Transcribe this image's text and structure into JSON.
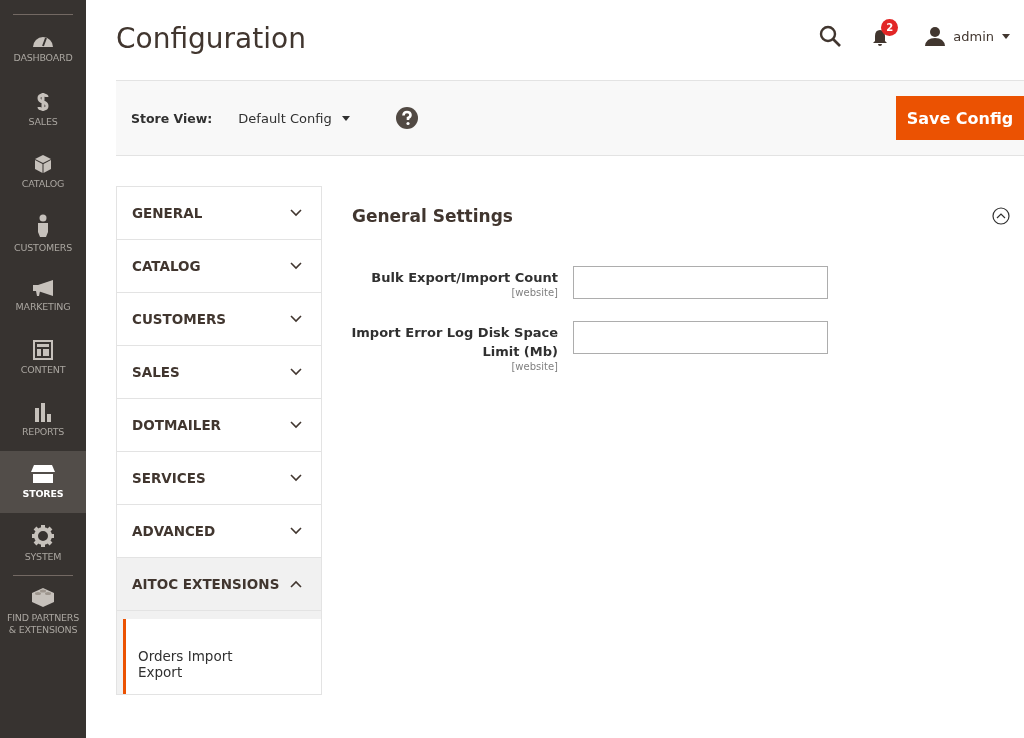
{
  "nav": [
    {
      "label": "DASHBOARD",
      "selected": false
    },
    {
      "label": "SALES",
      "selected": false
    },
    {
      "label": "CATALOG",
      "selected": false
    },
    {
      "label": "CUSTOMERS",
      "selected": false
    },
    {
      "label": "MARKETING",
      "selected": false
    },
    {
      "label": "CONTENT",
      "selected": false
    },
    {
      "label": "REPORTS",
      "selected": false
    },
    {
      "label": "STORES",
      "selected": true
    },
    {
      "label": "SYSTEM",
      "selected": false
    },
    {
      "label": "FIND PARTNERS & EXTENSIONS",
      "selected": false
    }
  ],
  "page_title": "Configuration",
  "notifications": {
    "count": "2"
  },
  "user": {
    "name": "admin"
  },
  "store_bar": {
    "label": "Store View:",
    "value": "Default Config",
    "button": "Save Config"
  },
  "sections": [
    {
      "label": "GENERAL",
      "expanded": false
    },
    {
      "label": "CATALOG",
      "expanded": false
    },
    {
      "label": "CUSTOMERS",
      "expanded": false
    },
    {
      "label": "SALES",
      "expanded": false
    },
    {
      "label": "DOTMAILER",
      "expanded": false
    },
    {
      "label": "SERVICES",
      "expanded": false
    },
    {
      "label": "ADVANCED",
      "expanded": false
    },
    {
      "label": "AITOC EXTENSIONS",
      "expanded": true,
      "children": [
        {
          "label": "Orders Import Export",
          "selected": true
        }
      ]
    }
  ],
  "group": {
    "title": "General Settings",
    "expanded": true,
    "fields": [
      {
        "label": "Bulk Export/Import Count",
        "scope": "[website]"
      },
      {
        "label": "Import Error Log Disk Space Limit (Mb)",
        "scope": "[website]"
      }
    ]
  }
}
